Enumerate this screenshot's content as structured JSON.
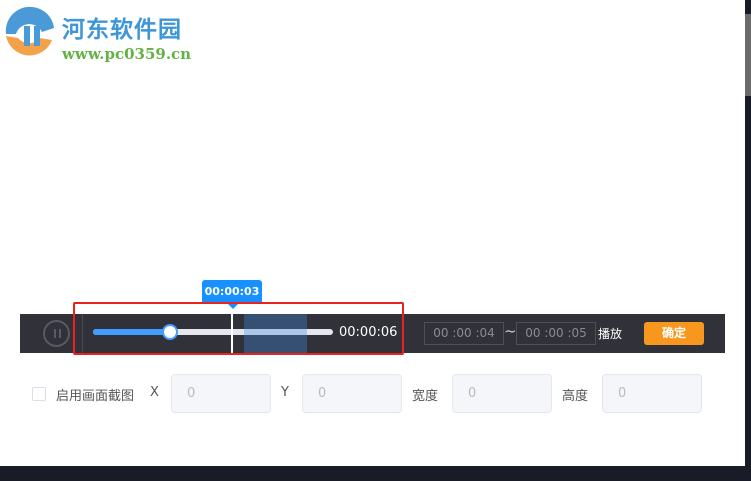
{
  "watermark": {
    "title": "河东软件园",
    "url": "www.pc0359.cn"
  },
  "player": {
    "current_tooltip": "00:00:03",
    "duration": "00:00:06",
    "progress_percent": 32,
    "range_start": "00 :00 :04",
    "range_end": "00 :00 :05",
    "range_sep": "~",
    "play_label": "播放",
    "confirm_label": "确定"
  },
  "crop": {
    "enable_label": "启用画面截图",
    "checked": false,
    "x_label": "X",
    "x_value": "0",
    "y_label": "Y",
    "y_value": "0",
    "width_label": "宽度",
    "width_value": "0",
    "height_label": "高度",
    "height_value": "0"
  },
  "colors": {
    "accent": "#409eff",
    "confirm": "#f7971e",
    "bar": "#31313a",
    "highlight": "#e8231f"
  }
}
